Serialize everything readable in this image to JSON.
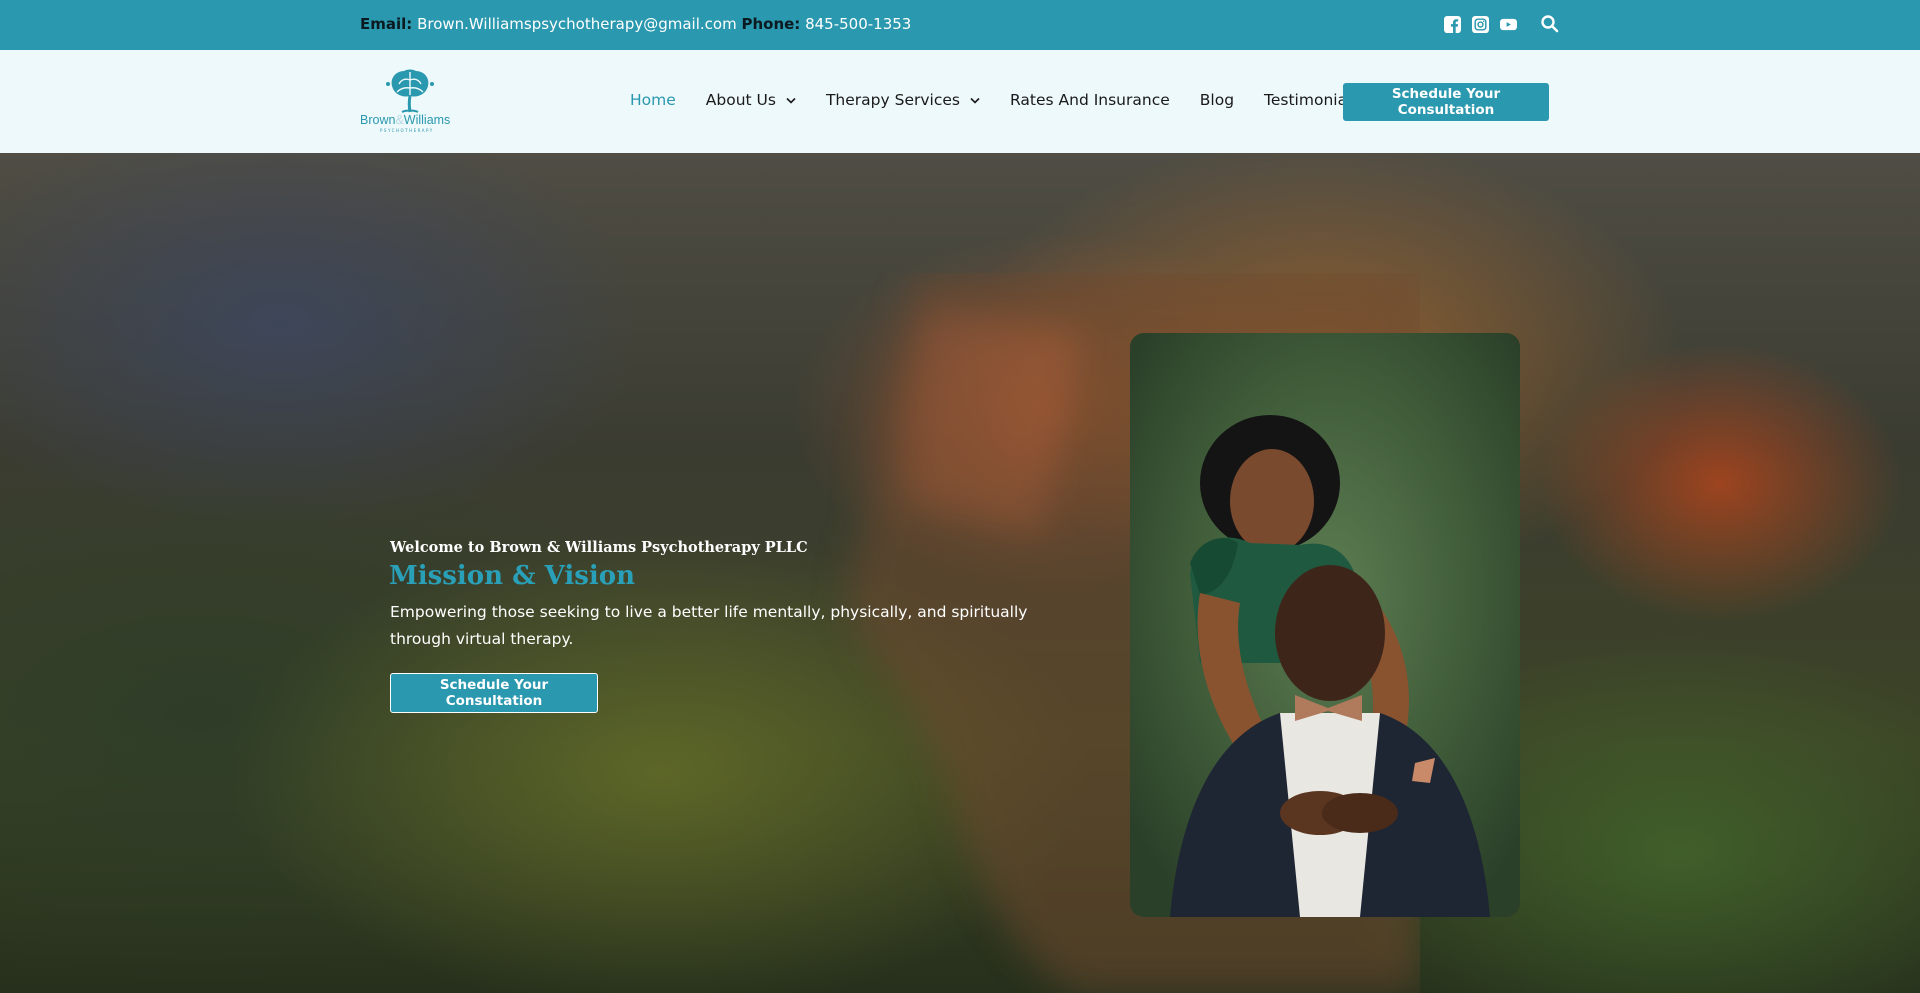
{
  "topbar": {
    "email_label": "Email:",
    "email_value": "Brown.Williamspsychotherapy@gmail.com",
    "phone_label": "Phone:",
    "phone_value": "845-500-1353",
    "social": [
      {
        "icon": "facebook-icon"
      },
      {
        "icon": "instagram-icon"
      },
      {
        "icon": "youtube-icon"
      }
    ],
    "search_icon": "search-icon"
  },
  "header": {
    "logo_name_first": "Brown",
    "logo_name_amp": "&",
    "logo_name_last": "Williams",
    "logo_sub": "PSYCHOTHERAPY",
    "nav": [
      {
        "label": "Home",
        "active": true
      },
      {
        "label": "About Us",
        "dropdown": true
      },
      {
        "label": "Therapy Services",
        "dropdown": true
      },
      {
        "label": "Rates And Insurance"
      },
      {
        "label": "Blog"
      },
      {
        "label": "Testimonials"
      }
    ],
    "cta_label": "Schedule Your Consultation"
  },
  "hero": {
    "welcome": "Welcome to Brown & Williams Psychotherapy PLLC",
    "heading": "Mission & Vision",
    "tagline": "Empowering those seeking to live a better life mentally, physically, and spiritually through virtual therapy.",
    "cta_label": "Schedule Your Consultation"
  },
  "colors": {
    "accent": "#2a98ae",
    "header_bg": "#eef9fb",
    "heading": "#2aa0b8"
  }
}
